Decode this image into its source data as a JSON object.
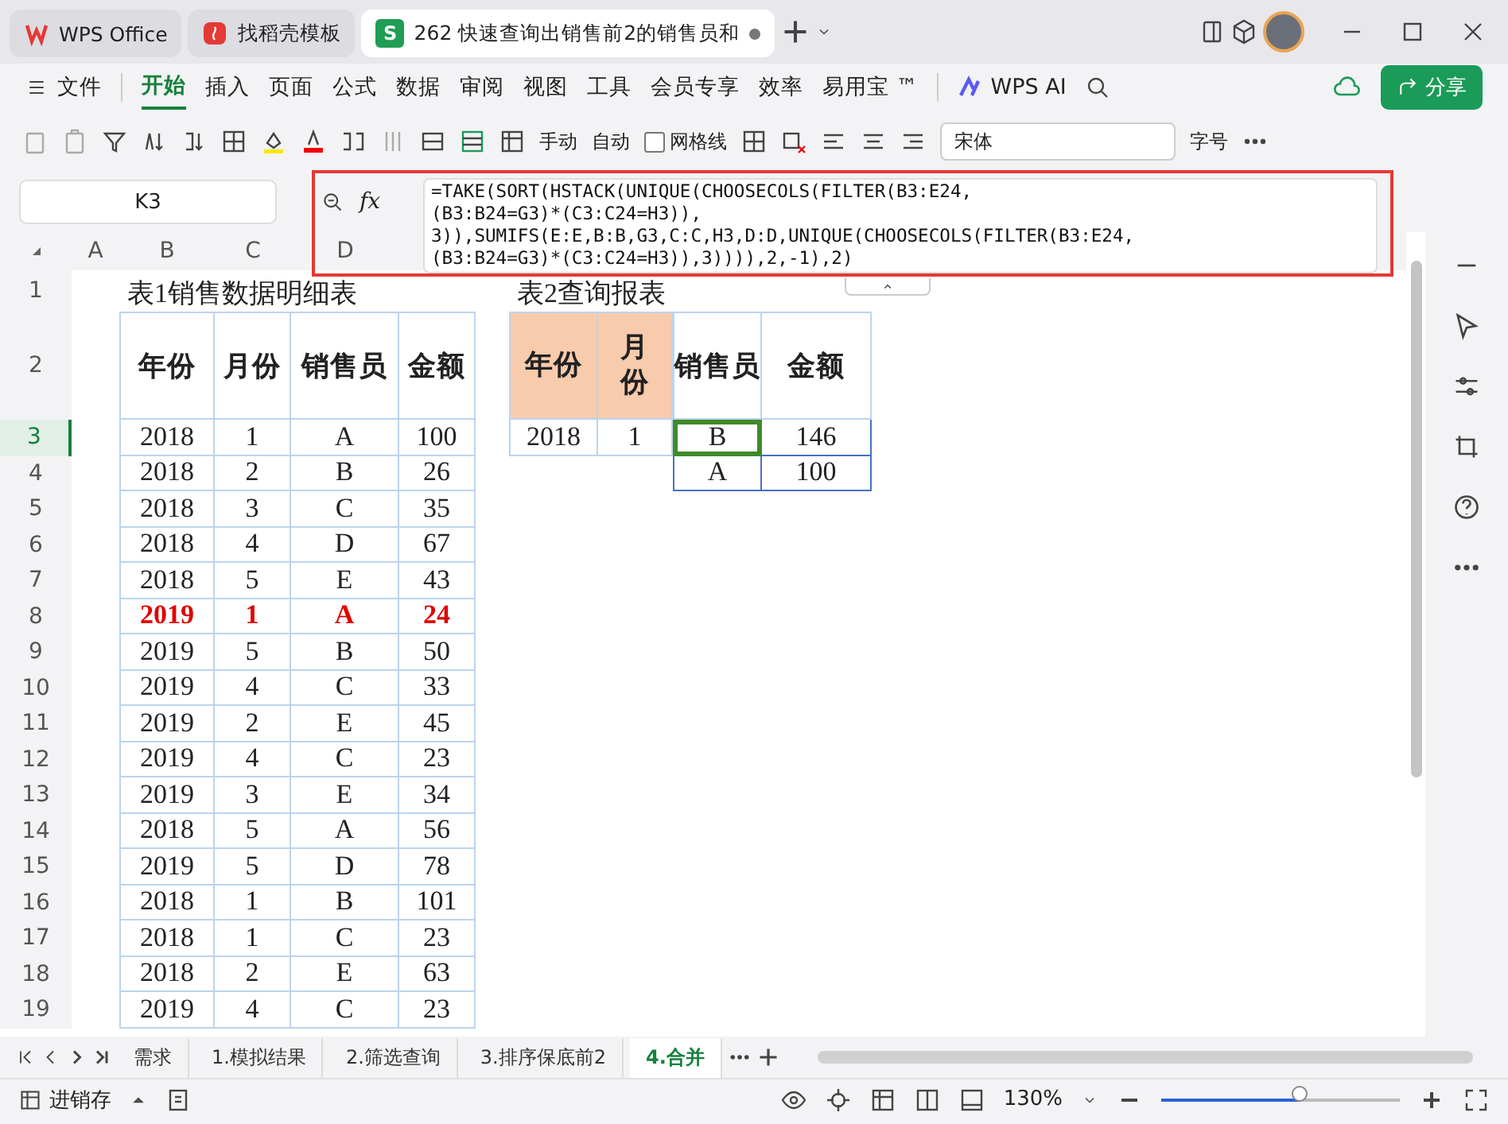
{
  "window": {
    "tabs": [
      {
        "kind": "wps",
        "label": "WPS Office",
        "selected": false,
        "modified": false
      },
      {
        "kind": "template",
        "label": "找稻壳模板",
        "selected": false,
        "modified": false
      },
      {
        "kind": "sheet",
        "badge": "S",
        "label": "262 快速查询出销售前2的销售员和",
        "selected": true,
        "modified": true
      }
    ]
  },
  "menu": {
    "file": "文件",
    "items": [
      {
        "label": "开始",
        "selected": true
      },
      {
        "label": "插入",
        "selected": false
      },
      {
        "label": "页面",
        "selected": false
      },
      {
        "label": "公式",
        "selected": false
      },
      {
        "label": "数据",
        "selected": false
      },
      {
        "label": "审阅",
        "selected": false
      },
      {
        "label": "视图",
        "selected": false
      },
      {
        "label": "工具",
        "selected": false
      },
      {
        "label": "会员专享",
        "selected": false
      },
      {
        "label": "效率",
        "selected": false
      },
      {
        "label": "易用宝 ™",
        "selected": false
      }
    ],
    "ai": "WPS AI",
    "share": "分享"
  },
  "toolbar": {
    "manual": "手动",
    "auto": "自动",
    "gridlines": {
      "label": "网格线",
      "checked": false
    },
    "font": "宋体",
    "font_size": "字号"
  },
  "formula_bar": {
    "name_box": "K3",
    "fx": "fx",
    "formula": "=TAKE(SORT(HSTACK(UNIQUE(CHOOSECOLS(FILTER(B3:E24,\n(B3:B24=G3)*(C3:C24=H3)),\n3)),SUMIFS(E:E,B:B,G3,C:C,H3,D:D,UNIQUE(CHOOSECOLS(FILTER(B3:E24,\n(B3:B24=G3)*(C3:C24=H3)),3)))),2,-1),2)"
  },
  "sheet": {
    "columns": [
      "A",
      "B",
      "C",
      "D"
    ],
    "rows": [
      {
        "label": "1",
        "selected": false
      },
      {
        "label": "2",
        "selected": false
      },
      {
        "label": "3",
        "selected": true
      },
      {
        "label": "4",
        "selected": false
      },
      {
        "label": "5",
        "selected": false
      },
      {
        "label": "6",
        "selected": false
      },
      {
        "label": "7",
        "selected": false
      },
      {
        "label": "8",
        "selected": false
      },
      {
        "label": "9",
        "selected": false
      },
      {
        "label": "10",
        "selected": false
      },
      {
        "label": "11",
        "selected": false
      },
      {
        "label": "12",
        "selected": false
      },
      {
        "label": "13",
        "selected": false
      },
      {
        "label": "14",
        "selected": false
      },
      {
        "label": "15",
        "selected": false
      },
      {
        "label": "16",
        "selected": false
      },
      {
        "label": "17",
        "selected": false
      },
      {
        "label": "18",
        "selected": false
      },
      {
        "label": "19",
        "selected": false
      }
    ],
    "table1": {
      "title": "表1销售数据明细表",
      "headers": [
        "年份",
        "月份",
        "销售员",
        "金额"
      ],
      "rows": [
        {
          "cells": [
            "2018",
            "1",
            "A",
            "100"
          ],
          "highlighted": false
        },
        {
          "cells": [
            "2018",
            "2",
            "B",
            "26"
          ],
          "highlighted": false
        },
        {
          "cells": [
            "2018",
            "3",
            "C",
            "35"
          ],
          "highlighted": false
        },
        {
          "cells": [
            "2018",
            "4",
            "D",
            "67"
          ],
          "highlighted": false
        },
        {
          "cells": [
            "2018",
            "5",
            "E",
            "43"
          ],
          "highlighted": false
        },
        {
          "cells": [
            "2019",
            "1",
            "A",
            "24"
          ],
          "highlighted": true
        },
        {
          "cells": [
            "2019",
            "5",
            "B",
            "50"
          ],
          "highlighted": false
        },
        {
          "cells": [
            "2019",
            "4",
            "C",
            "33"
          ],
          "highlighted": false
        },
        {
          "cells": [
            "2019",
            "2",
            "E",
            "45"
          ],
          "highlighted": false
        },
        {
          "cells": [
            "2019",
            "4",
            "C",
            "23"
          ],
          "highlighted": false
        },
        {
          "cells": [
            "2019",
            "3",
            "E",
            "34"
          ],
          "highlighted": false
        },
        {
          "cells": [
            "2018",
            "5",
            "A",
            "56"
          ],
          "highlighted": false
        },
        {
          "cells": [
            "2019",
            "5",
            "D",
            "78"
          ],
          "highlighted": false
        },
        {
          "cells": [
            "2018",
            "1",
            "B",
            "101"
          ],
          "highlighted": false
        },
        {
          "cells": [
            "2018",
            "1",
            "C",
            "23"
          ],
          "highlighted": false
        },
        {
          "cells": [
            "2018",
            "2",
            "E",
            "63"
          ],
          "highlighted": false
        },
        {
          "cells": [
            "2019",
            "4",
            "C",
            "23"
          ],
          "highlighted": false
        }
      ]
    },
    "table2": {
      "title": "表2查询报表",
      "headers": [
        "年份",
        "月份"
      ],
      "rows": [
        {
          "cells": [
            "2018",
            "1"
          ]
        }
      ]
    },
    "table3": {
      "headers": [
        "销售员",
        "金额"
      ],
      "rows": [
        {
          "cells": [
            "B",
            "146"
          ],
          "selected": true
        },
        {
          "cells": [
            "A",
            "100"
          ],
          "selected": false
        }
      ]
    }
  },
  "sheet_tabs": [
    {
      "label": "需求",
      "selected": false
    },
    {
      "label": "1.模拟结果",
      "selected": false
    },
    {
      "label": "2.筛选查询",
      "selected": false
    },
    {
      "label": "3.排序保底前2",
      "selected": false
    },
    {
      "label": "4.合并",
      "selected": true
    }
  ],
  "status_bar": {
    "workbook": "进销存",
    "zoom": "130%",
    "zoom_slider": {
      "level": 0.58
    }
  }
}
